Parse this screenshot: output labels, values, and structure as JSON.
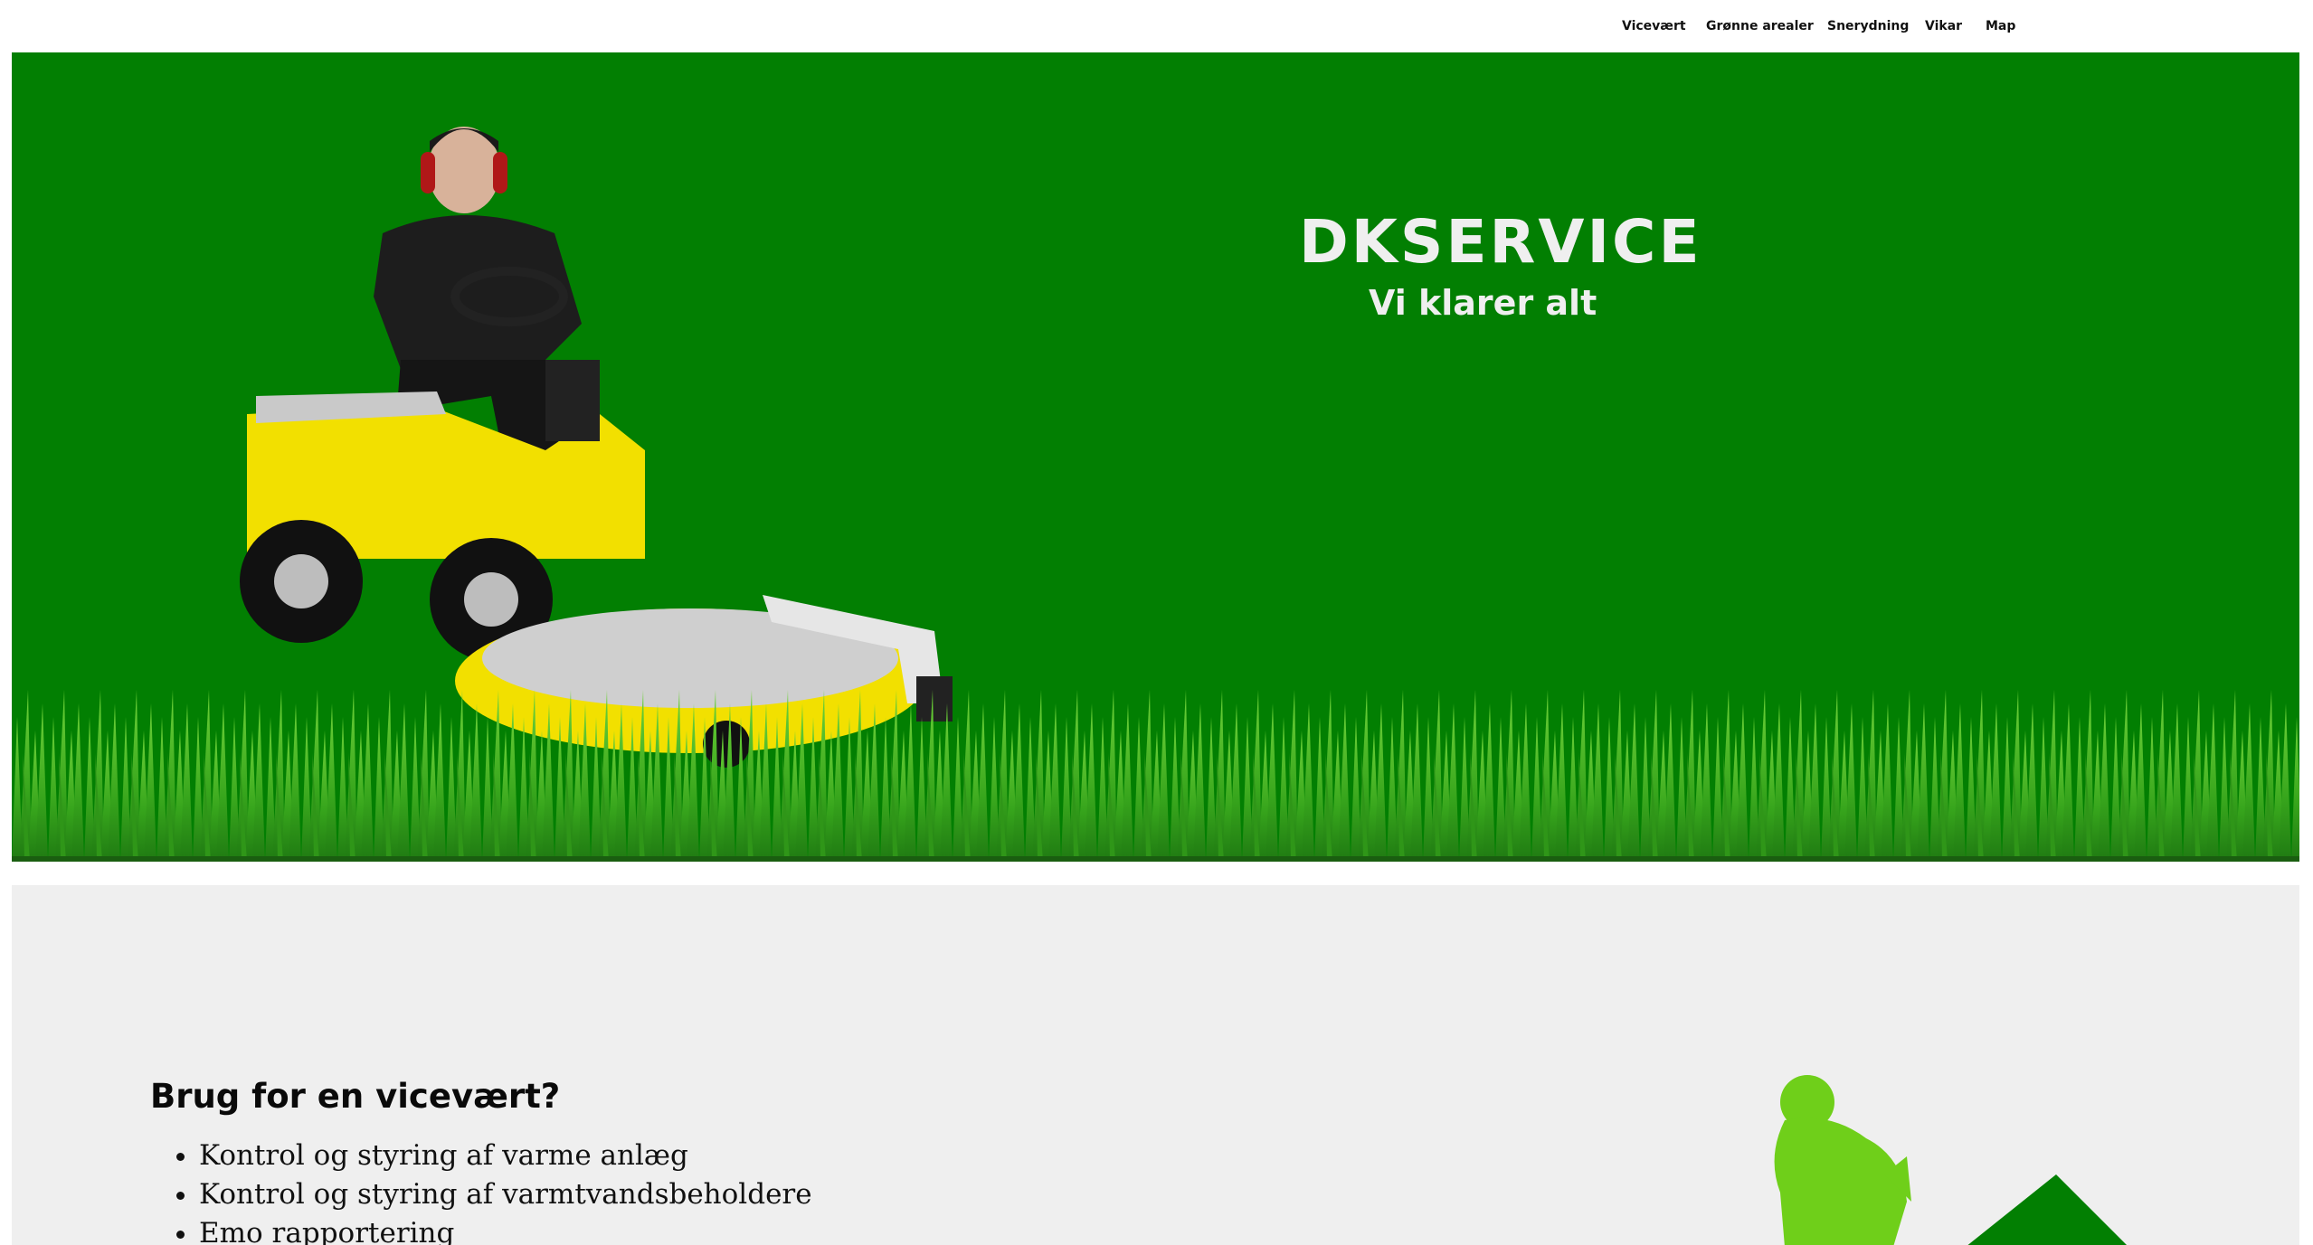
{
  "nav": {
    "items": [
      {
        "label": "Vicevært"
      },
      {
        "label": "Grønne arealer"
      },
      {
        "label": "Snerydning"
      },
      {
        "label": "Vikar"
      },
      {
        "label": "Map"
      }
    ]
  },
  "hero": {
    "title": "DKSERVICE",
    "subtitle": "Vi klarer alt",
    "bg_color": "#027f02",
    "image": "man-on-riding-lawn-mower"
  },
  "section": {
    "title": "Brug for en vicevært?",
    "bg_color": "#efefef",
    "items": [
      "Kontrol og styring af varme anlæg",
      "Kontrol og styring af varmtvandsbeholdere",
      "Emo rapportering"
    ],
    "illustration": "green-worker-silhouette"
  },
  "colors": {
    "accent": "#027f02",
    "grass": "#3fae1e",
    "mower_yellow": "#f2e000",
    "silhouette": "#6fcf1a"
  }
}
